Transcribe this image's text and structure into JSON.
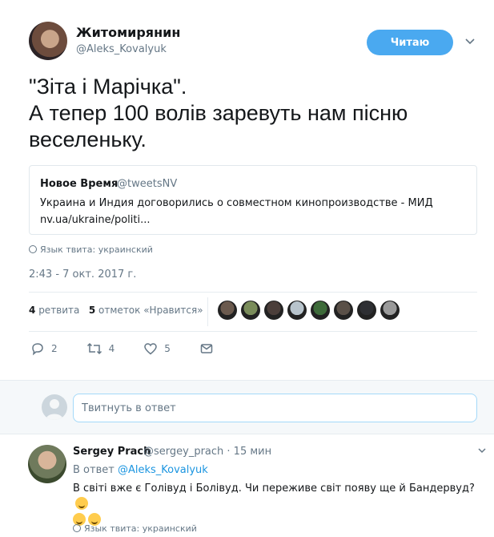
{
  "tweet": {
    "author_name": "Житомирянин",
    "author_handle": "@Aleks_Kovalyuk",
    "follow_label": "Читаю",
    "text": "\"Зіта і Марічка\".\nА тепер 100 волів заревуть нам пісню веселеньку.",
    "quote": {
      "name": "Новое Время",
      "handle": "@tweetsNV",
      "text": "Украина и Индия договорились о совместном кинопроизводстве - МИД",
      "link": "nv.ua/ukraine/politi..."
    },
    "language": "Язык твита: украинский",
    "timestamp": "2:43 - 7 окт. 2017 г.",
    "retweets_count": "4",
    "retweets_label": "ретвита",
    "likes_count": "5",
    "likes_label": "отметок «Нравится»",
    "likers": [
      "#6b5a4e",
      "#7a8c5a",
      "#4b3e3a",
      "#b8c4cc",
      "#3e6b3a",
      "#5a5048",
      "#2e2f33",
      "#9a9a9a"
    ],
    "actions": {
      "replies": "2",
      "retweets": "4",
      "likes": "5"
    }
  },
  "reply_box": {
    "placeholder": "Твитнуть в ответ"
  },
  "reply": {
    "author_name": "Sergey Prach",
    "meta": "@sergey_prach · 15 мин",
    "reply_to_prefix": "В ответ",
    "reply_to_handle": "@Aleks_Kovalyuk",
    "text": "В світі вже є Голівуд і Болівуд. Чи переживе світ появу ще й Бандервуд?",
    "language": "Язык твита: украинский"
  },
  "colors": {
    "accent": "#4aa9f0",
    "link": "#1b95e0",
    "muted": "#657786"
  },
  "icons": [
    "caret-down-icon",
    "globe-icon",
    "reply-icon",
    "retweet-icon",
    "heart-icon",
    "message-icon",
    "smile-emoji"
  ]
}
